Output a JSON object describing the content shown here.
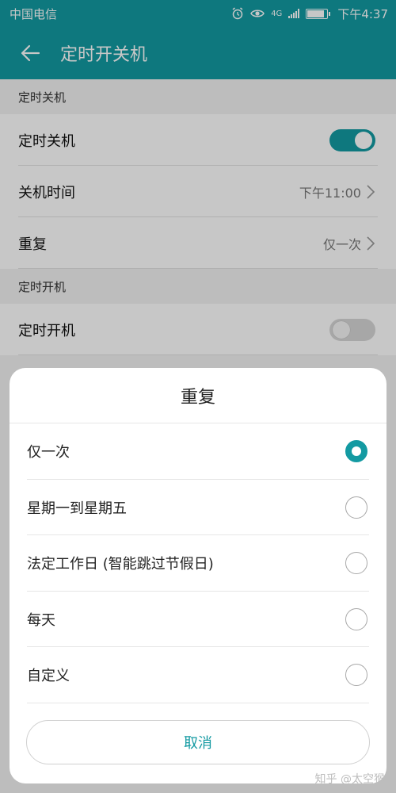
{
  "status_bar": {
    "carrier": "中国电信",
    "network": "4G",
    "time": "下午4:37",
    "battery_level": 0.9,
    "icons": [
      "alarm-icon",
      "eye-icon",
      "signal-icon",
      "battery-icon"
    ]
  },
  "app_bar": {
    "title": "定时开关机",
    "back_icon": "arrow-left-icon",
    "color": "#139aa2"
  },
  "sections": {
    "shutdown": {
      "header": "定时关机",
      "toggle_label": "定时关机",
      "toggle_on": true,
      "time_label": "关机时间",
      "time_value": "下午11:00",
      "repeat_label": "重复",
      "repeat_value": "仅一次"
    },
    "startup": {
      "header": "定时开机",
      "toggle_label": "定时开机",
      "toggle_on": false
    }
  },
  "dialog": {
    "title": "重复",
    "options": [
      {
        "label": "仅一次",
        "selected": true
      },
      {
        "label": "星期一到星期五",
        "selected": false
      },
      {
        "label": "法定工作日 (智能跳过节假日)",
        "selected": false
      },
      {
        "label": "每天",
        "selected": false
      },
      {
        "label": "自定义",
        "selected": false
      }
    ],
    "cancel_label": "取消"
  },
  "watermark": "知乎 @太空猴"
}
